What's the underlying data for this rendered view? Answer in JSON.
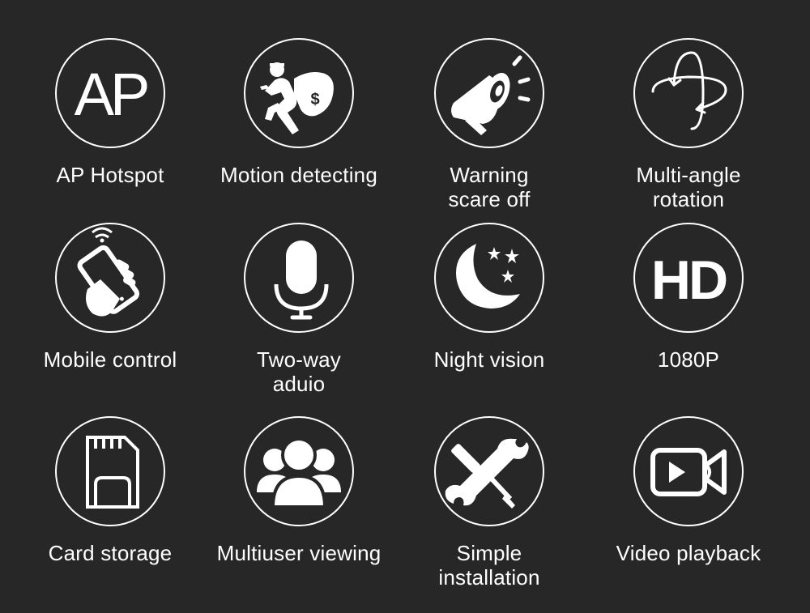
{
  "background_color": "#272727",
  "foreground_color": "#ffffff",
  "features": [
    {
      "icon": "ap-text-icon",
      "icon_text": "AP",
      "label_lines": [
        "AP Hotspot"
      ]
    },
    {
      "icon": "thief-money-bag-icon",
      "icon_text": "$",
      "label_lines": [
        "Motion detecting"
      ]
    },
    {
      "icon": "megaphone-icon",
      "label_lines": [
        "Warning",
        "scare off"
      ]
    },
    {
      "icon": "rotation-orbit-icon",
      "label_lines": [
        "Multi-angle",
        "rotation"
      ]
    },
    {
      "icon": "phone-in-hand-wifi-icon",
      "label_lines": [
        "Mobile control"
      ]
    },
    {
      "icon": "microphone-icon",
      "label_lines": [
        "Two-way",
        "aduio"
      ]
    },
    {
      "icon": "moon-stars-icon",
      "label_lines": [
        "Night vision"
      ]
    },
    {
      "icon": "hd-text-icon",
      "icon_text": "HD",
      "label_lines": [
        "1080P"
      ]
    },
    {
      "icon": "sd-card-icon",
      "label_lines": [
        "Card storage"
      ]
    },
    {
      "icon": "user-group-icon",
      "label_lines": [
        "Multiuser viewing"
      ]
    },
    {
      "icon": "wrench-screwdriver-icon",
      "label_lines": [
        "Simple",
        "installation"
      ]
    },
    {
      "icon": "video-camera-play-icon",
      "label_lines": [
        "Video playback"
      ]
    }
  ]
}
